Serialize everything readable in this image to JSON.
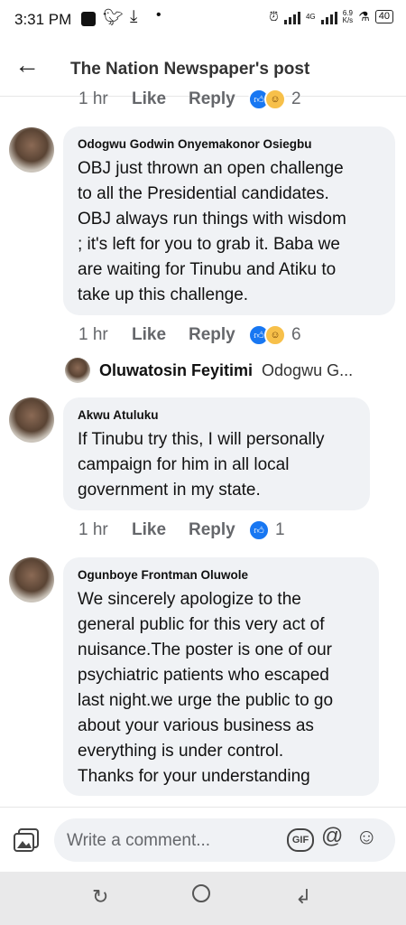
{
  "status_bar": {
    "time": "3:31 PM",
    "network": "4G",
    "speed_value": "6.9",
    "speed_unit": "K/s",
    "battery": "40"
  },
  "header": {
    "title": "The Nation Newspaper's post"
  },
  "partial_actions": {
    "time": "1 hr",
    "like": "Like",
    "reply": "Reply",
    "reaction_count": "2"
  },
  "comments": [
    {
      "author": "Odogwu Godwin Onyemakonor Osiegbu",
      "lines": [
        "OBJ just thrown an open challenge",
        "to all the Presidential candidates.",
        "OBJ always run things with wisdom",
        "; it's left for you to grab it. Baba we",
        "are waiting for Tinubu and Atiku to",
        "take up this challenge."
      ],
      "time": "1 hr",
      "like": "Like",
      "reply": "Reply",
      "reaction_count": "6"
    },
    {
      "author": "Akwu Atuluku",
      "lines": [
        "If Tinubu try this, I will personally",
        "campaign for him in all local",
        "government in my state."
      ],
      "time": "1 hr",
      "like": "Like",
      "reply": "Reply",
      "reaction_count": "1"
    },
    {
      "author": "Ogunboye Frontman Oluwole",
      "lines": [
        "We sincerely apologize to the",
        "general public for this very act of",
        "nuisance.The poster is one of our",
        "psychiatric patients who escaped",
        "last night.we urge the public to go",
        "about your various business as",
        "everything is under control.",
        "Thanks for your understanding"
      ]
    }
  ],
  "reply_preview": {
    "author": "Oluwatosin Feyitimi",
    "snippet": "Odogwu G..."
  },
  "composer": {
    "placeholder": "Write a comment...",
    "gif_label": "GIF"
  }
}
